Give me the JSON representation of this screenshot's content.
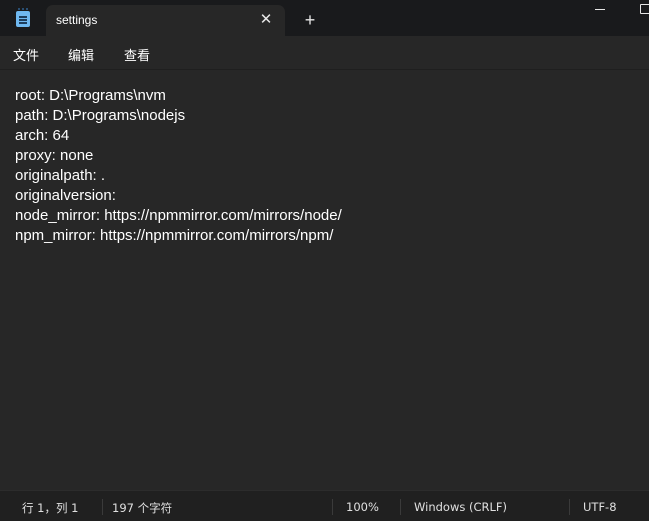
{
  "window": {
    "tab_title": "settings",
    "close_glyph": "✕",
    "new_tab_glyph": "+",
    "accent_color": "#6fb8f0"
  },
  "menu": {
    "items": [
      "文件",
      "编辑",
      "查看"
    ]
  },
  "editor": {
    "lines": [
      "root: D:\\Programs\\nvm",
      "path: D:\\Programs\\nodejs",
      "arch: 64",
      "proxy: none",
      "originalpath: .",
      "originalversion:",
      "node_mirror: https://npmmirror.com/mirrors/node/",
      "npm_mirror: https://npmmirror.com/mirrors/npm/"
    ]
  },
  "status": {
    "position": "行 1，列 1",
    "char_count": "197 个字符",
    "zoom": "100%",
    "line_ending": "Windows (CRLF)",
    "encoding": "UTF-8"
  }
}
